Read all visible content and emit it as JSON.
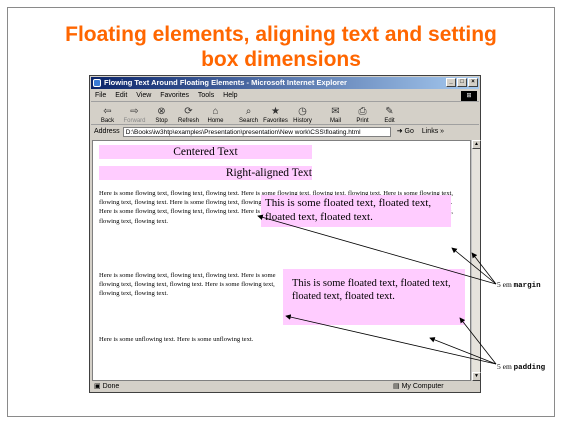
{
  "slide": {
    "title": "Floating elements, aligning text and setting box dimensions"
  },
  "window": {
    "title": "Flowing Text Around Floating Elements - Microsoft Internet Explorer",
    "buttons": [
      "_",
      "□",
      "×"
    ]
  },
  "menu": [
    "File",
    "Edit",
    "View",
    "Favorites",
    "Tools",
    "Help"
  ],
  "toolbar": [
    {
      "label": "Back",
      "icon": "back-icon",
      "glyph": "⇦",
      "disabled": false
    },
    {
      "label": "Forward",
      "icon": "forward-icon",
      "glyph": "⇨",
      "disabled": true
    },
    {
      "label": "Stop",
      "icon": "stop-icon",
      "glyph": "⊗",
      "disabled": false
    },
    {
      "label": "Refresh",
      "icon": "refresh-icon",
      "glyph": "⟳",
      "disabled": false
    },
    {
      "label": "Home",
      "icon": "home-icon",
      "glyph": "⌂",
      "disabled": false
    },
    {
      "label": "Search",
      "icon": "search-icon",
      "glyph": "⌕",
      "disabled": false
    },
    {
      "label": "Favorites",
      "icon": "favorites-icon",
      "glyph": "★",
      "disabled": false
    },
    {
      "label": "History",
      "icon": "history-icon",
      "glyph": "◷",
      "disabled": false
    },
    {
      "label": "Mail",
      "icon": "mail-icon",
      "glyph": "✉",
      "disabled": false
    },
    {
      "label": "Print",
      "icon": "print-icon",
      "glyph": "⎙",
      "disabled": false
    },
    {
      "label": "Edit",
      "icon": "edit-icon",
      "glyph": "✎",
      "disabled": false
    }
  ],
  "address": {
    "label": "Address",
    "value": "D:\\Books\\iw3htp\\examples\\Presentation\\presentation\\New work\\CSS\\floating.html",
    "go": "Go",
    "links": "Links »"
  },
  "content": {
    "centered": "Centered Text",
    "right_aligned": "Right-aligned Text",
    "para1": "Here is some flowing text, flowing text, flowing text. Here is some flowing text, flowing text, flowing text. Here is some flowing text, flowing text, flowing text. Here is some flowing text, flowing text, flowing text. Here is some flowing text, flowing text, flowing text. Here is some flowing text, flowing text, flowing text. Here is some flowing text, flowing text, flowing text. Here is some flowing text, flowing text, flowing text.",
    "float1": "This is some floated text, floated text, floated text, floated text.",
    "para2": "Here is some flowing text, flowing text, flowing text. Here is some flowing text, flowing text, flowing text. Here is some flowing text, flowing text, flowing text.",
    "float2": "This is some floated text, floated text, floated text, floated text.",
    "para3": "Here is some unflowing text. Here is some unflowing text."
  },
  "status": {
    "left": "Done",
    "right": "My Computer"
  },
  "annotations": {
    "margin_prefix": "5 em ",
    "margin_code": "margin",
    "padding_prefix": "5 em ",
    "padding_code": "padding"
  },
  "colors": {
    "title": "#ff6600",
    "highlight": "#ffccff",
    "titlebar": "#0a246a"
  }
}
